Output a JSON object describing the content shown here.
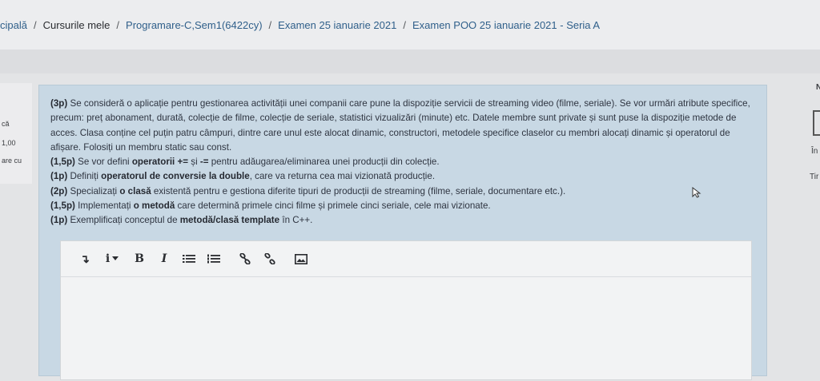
{
  "breadcrumb": {
    "items": [
      "cipală",
      "Cursurile mele",
      "Programare-C,Sem1(6422cy)",
      "Examen 25 ianuarie 2021",
      "Examen POO 25 ianuarie 2021 - Seria A"
    ],
    "separator": "/"
  },
  "left_panel": {
    "line1": "că",
    "line2": "1,00",
    "line3": "are cu"
  },
  "right_panel": {
    "letter": "N",
    "line1": "În",
    "line2": "Tir"
  },
  "question": {
    "p1_lead": "(3p)",
    "p1_text": " Se consideră o aplicație pentru gestionarea activității unei companii care pune la dispoziție servicii de streaming video (filme, seriale). Se vor urmări atribute specifice, precum: preț abonament, durată, colecție de filme, colecție de seriale, statistici vizualizări (minute) etc. Datele membre sunt private și sunt puse la dispoziție metode de acces. Clasa conține cel puțin patru câmpuri, dintre care unul este alocat dinamic, constructori, metodele specifice claselor cu membri alocați dinamic și operatorul de afișare. Folosiți un membru static sau const.",
    "p2_lead": "(1,5p)",
    "p2_a": " Se vor defini ",
    "p2_b": "operatorii += ",
    "p2_c": "și ",
    "p2_d": "-=",
    "p2_e": " pentru adăugarea/eliminarea unei producții din colecție.",
    "p3_lead": "(1p)",
    "p3_a": " Definiți ",
    "p3_b": "operatorul de conversie la double",
    "p3_c": ", care va returna cea mai vizionată producție.",
    "p4_lead": "(2p)",
    "p4_a": " Specializați ",
    "p4_b": "o clasă",
    "p4_c": " existentă pentru e gestiona diferite tipuri de producții de streaming (filme, seriale, documentare etc.).",
    "p5_lead": "(1,5p)",
    "p5_a": " Implementați ",
    "p5_b": "o metodă",
    "p5_c": " care determină primele cinci filme și primele cinci seriale, cele mai vizionate.",
    "p6_lead": "(1p)",
    "p6_a": " Exemplificați conceptul de ",
    "p6_b": "metodă/clasă template",
    "p6_c": " în C++."
  },
  "toolbar": {
    "undo_glyph": "↴",
    "info_glyph": "i",
    "bold_glyph": "B",
    "italic_glyph": "I"
  },
  "colors": {
    "question_bg": "#c8d8e4",
    "link": "#2f5f8a"
  }
}
